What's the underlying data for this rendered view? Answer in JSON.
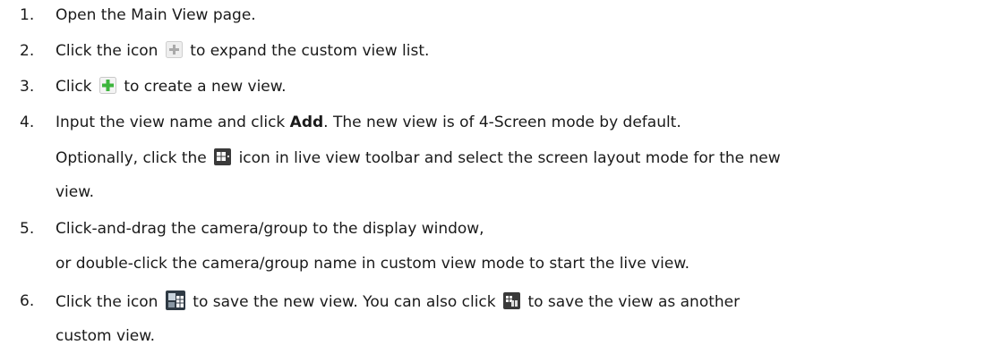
{
  "steps": [
    {
      "number": "1.",
      "text": "Open the Main View page."
    },
    {
      "number": "2.",
      "before": "Click the icon",
      "after": "to expand the custom view list.",
      "icon": "expand-plus-icon"
    },
    {
      "number": "3.",
      "before": "Click",
      "after": "to create a new view.",
      "icon": "add-view-icon"
    },
    {
      "number": "4.",
      "text_a": "Input the view name and click",
      "bold": "Add",
      "text_b": ". The new view is of 4-Screen mode by default.",
      "opt_before": "Optionally, click the",
      "opt_after": "icon in live view toolbar and select the screen layout mode for the new",
      "opt_line3": "view.",
      "icon": "screen-layout-icon"
    },
    {
      "number": "5.",
      "line1": "Click-and-drag the camera/group to the display window,",
      "line2": "or double-click the camera/group name in custom view mode to start the live view."
    },
    {
      "number": "6.",
      "before": "Click the icon",
      "middle": "to save the new view. You can also click",
      "after": "to save the view as another",
      "line2": "custom view.",
      "icon_save": "save-view-icon",
      "icon_save_as": "save-as-view-icon"
    }
  ]
}
